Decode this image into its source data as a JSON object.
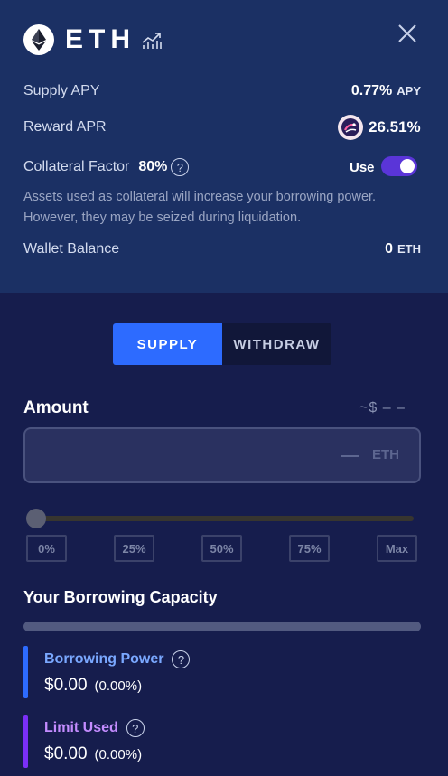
{
  "asset": {
    "symbol": "ETH",
    "icons": {
      "logo": "ethereum-logo-icon",
      "chart": "chart-trend-icon",
      "close": "close-icon"
    }
  },
  "rows": {
    "supply_apy": {
      "label": "Supply APY",
      "value": "0.77%",
      "unit": "APY"
    },
    "reward_apr": {
      "label": "Reward APR",
      "value": "26.51%",
      "icon": "reward-token-icon"
    },
    "collateral": {
      "label": "Collateral Factor",
      "value": "80%",
      "help": "?",
      "use_label": "Use",
      "use_enabled": true
    },
    "note": "Assets used as collateral will increase your borrowing power. However, they may be seized during liquidation.",
    "wallet": {
      "label": "Wallet Balance",
      "value": "0",
      "unit": "ETH"
    }
  },
  "tabs": [
    {
      "label": "SUPPLY",
      "active": true
    },
    {
      "label": "WITHDRAW",
      "active": false
    }
  ],
  "amount": {
    "label": "Amount",
    "usd_value": "~$ – –",
    "input_value": "",
    "unit": "ETH",
    "slider_percent": 0,
    "presets": [
      "0%",
      "25%",
      "50%",
      "75%",
      "Max"
    ]
  },
  "capacity": {
    "title": "Your Borrowing Capacity",
    "fill_fraction": 0,
    "borrowing_power": {
      "label": "Borrowing Power",
      "help": "?",
      "value": "$0.00",
      "percent": "(0.00%)"
    },
    "limit_used": {
      "label": "Limit Used",
      "help": "?",
      "value": "$0.00",
      "percent": "(0.00%)"
    }
  },
  "colors": {
    "top_background": "#1b3064",
    "bottom_background": "#161d4d",
    "accent_blue": "#2d6bff",
    "accent_purple": "#7b2ff7",
    "toggle": "#5a35d8",
    "borrowing_power_label": "#7aa8ff",
    "limit_used_label": "#c48cff"
  }
}
